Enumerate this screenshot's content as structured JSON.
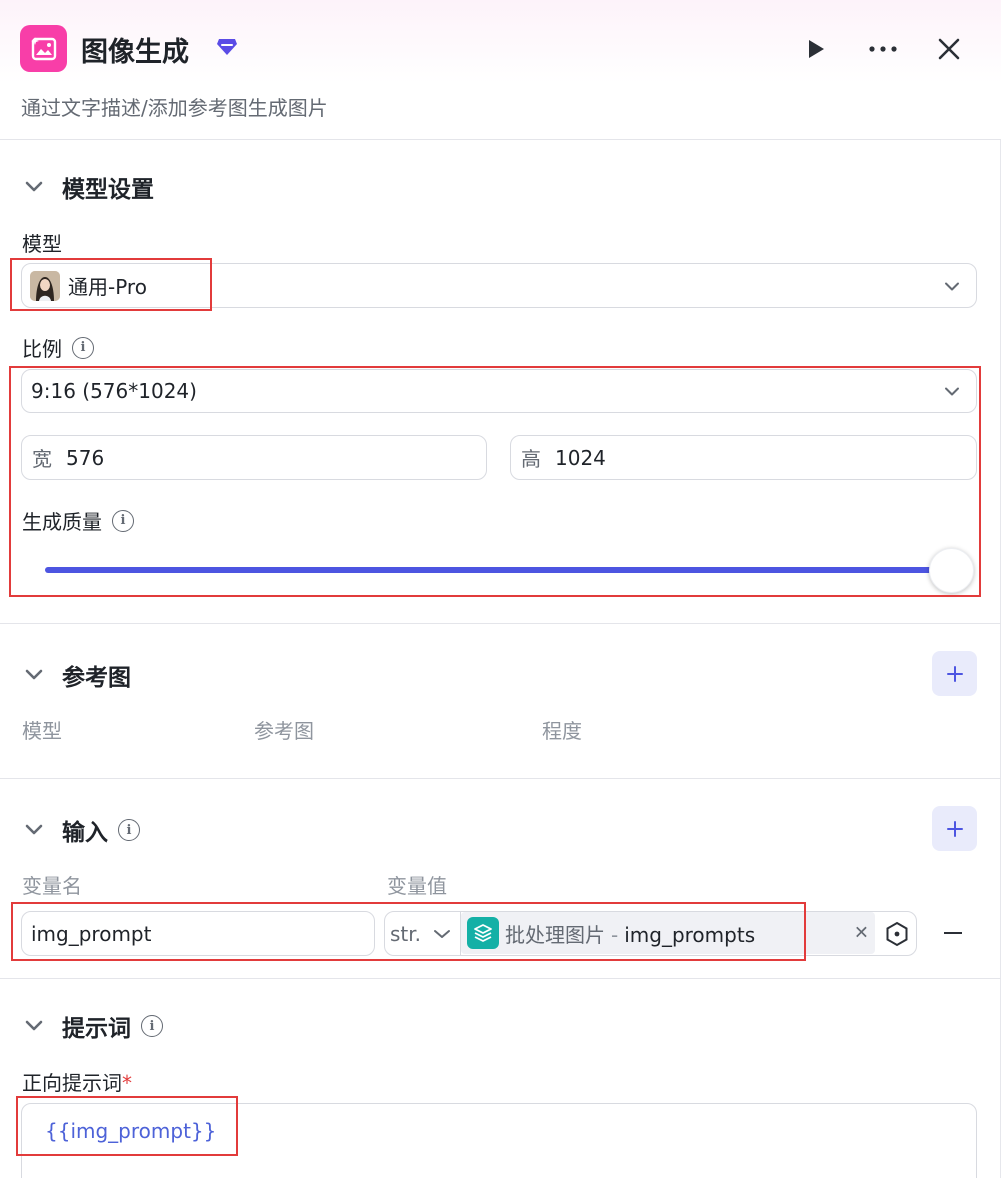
{
  "header": {
    "title": "图像生成",
    "subtitle": "通过文字描述/添加参考图生成图片",
    "icons": {
      "app": "image-icon",
      "badge": "diamond-icon",
      "run": "play-icon",
      "more": "more-icon",
      "close": "close-icon"
    }
  },
  "model_settings": {
    "title": "模型设置",
    "model_label": "模型",
    "model_value": "通用-Pro",
    "ratio_label": "比例",
    "ratio_value": "9:16 (576*1024)",
    "width_label": "宽",
    "width_value": "576",
    "height_label": "高",
    "height_value": "1024",
    "quality_label": "生成质量",
    "quality_level": 1.0
  },
  "reference": {
    "title": "参考图",
    "columns": [
      "模型",
      "参考图",
      "程度"
    ]
  },
  "input": {
    "title": "输入",
    "col_name": "变量名",
    "col_value": "变量值",
    "rows": [
      {
        "name": "img_prompt",
        "type": "str.",
        "source": "批处理图片",
        "separator": "-",
        "variable": "img_prompts"
      }
    ]
  },
  "prompt": {
    "title": "提示词",
    "positive_label": "正向提示词",
    "required_mark": "*",
    "positive_value": "{{img_prompt}}"
  },
  "colors": {
    "accent": "#4d55e1",
    "app_icon": "#f83ea8",
    "batch_icon": "#14b0a6",
    "highlight": "#e23b3b",
    "template_text": "#4d62d8"
  }
}
